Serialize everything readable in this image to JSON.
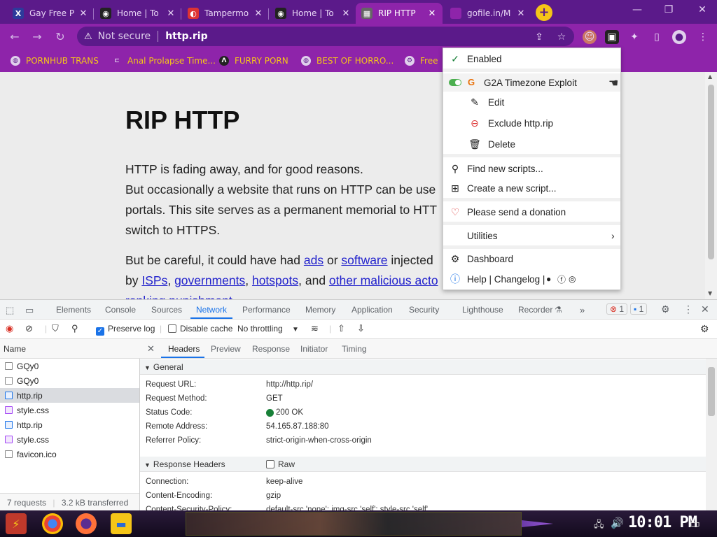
{
  "tabs": [
    {
      "title": "Gay Free P",
      "fav": "X",
      "fav_color": "#2d3a9b"
    },
    {
      "title": "Home | To",
      "fav": "⬤",
      "fav_color": "#222"
    },
    {
      "title": "Tampermo",
      "fav": "◐",
      "fav_color": "#d33"
    },
    {
      "title": "Home | To",
      "fav": "⬤",
      "fav_color": "#222"
    },
    {
      "title": "RIP HTTP",
      "fav": "▦",
      "fav_color": "#666"
    },
    {
      "title": "gofile.in/M",
      "fav": "",
      "fav_color": "#8e24aa"
    }
  ],
  "toolbar": {
    "not_secure": "Not secure",
    "url": "http.rip"
  },
  "bookmarks": [
    {
      "label": "PORNHUB TRANS",
      "icon": "globe-icon"
    },
    {
      "label": "Anal Prolapse Time...",
      "icon": "bookmark-icon"
    },
    {
      "label": "FURRY PORN",
      "icon": "lambda-icon"
    },
    {
      "label": "BEST OF HORRO...",
      "icon": "globe-icon"
    },
    {
      "label": "Free",
      "icon": "bookmark-icon"
    }
  ],
  "page": {
    "title": "RIP HTTP",
    "para1_l1": "HTTP is fading away, and for good reasons.",
    "para1_l2": "But occasionally a website that runs on HTTP can be use",
    "para1_l3": "portals. This site serves as a permanent memorial to HTT",
    "para1_l4": "switch to HTTPS.",
    "para2_pre": "But be careful, it could have had ",
    "para2_ads": "ads",
    "para2_or": " or ",
    "para2_software": "software",
    "para2_post": " injected",
    "para3_by": "by ",
    "para3_isps": "ISPs",
    "para3_c1": ", ",
    "para3_govs": "governments",
    "para3_c2": ", ",
    "para3_hotspots": "hotspots",
    "para3_and": ", and ",
    "para3_other": "other malicious acto",
    "para4": "ranking punishment."
  },
  "tampermonkey": {
    "enabled": "Enabled",
    "script": "G2A Timezone Exploit",
    "edit": "Edit",
    "exclude": "Exclude http.rip",
    "delete": "Delete",
    "find": "Find new scripts...",
    "create": "Create a new script...",
    "donate": "Please send a donation",
    "utilities": "Utilities",
    "dashboard": "Dashboard",
    "help": "Help | Changelog |"
  },
  "devtools": {
    "tabs": [
      "Elements",
      "Console",
      "Sources",
      "Network",
      "Performance",
      "Memory",
      "Application",
      "Security",
      "Lighthouse",
      "Recorder"
    ],
    "errors": "1",
    "messages": "1",
    "preserve_log": "Preserve log",
    "disable_cache": "Disable cache",
    "throttling": "No throttling",
    "name_header": "Name",
    "requests": [
      {
        "name": "GQy0",
        "type": "other"
      },
      {
        "name": "GQy0",
        "type": "other"
      },
      {
        "name": "http.rip",
        "type": "doc"
      },
      {
        "name": "style.css",
        "type": "css"
      },
      {
        "name": "http.rip",
        "type": "doc"
      },
      {
        "name": "style.css",
        "type": "css"
      },
      {
        "name": "favicon.ico",
        "type": "other"
      }
    ],
    "footer_requests": "7 requests",
    "footer_transferred": "3.2 kB transferred",
    "detail_tabs": [
      "Headers",
      "Preview",
      "Response",
      "Initiator",
      "Timing"
    ],
    "general": "General",
    "general_rows": [
      {
        "k": "Request URL:",
        "v": "http://http.rip/"
      },
      {
        "k": "Request Method:",
        "v": "GET"
      },
      {
        "k": "Status Code:",
        "v": "200 OK"
      },
      {
        "k": "Remote Address:",
        "v": "54.165.87.188:80"
      },
      {
        "k": "Referrer Policy:",
        "v": "strict-origin-when-cross-origin"
      }
    ],
    "response_headers": "Response Headers",
    "raw": "Raw",
    "resp_rows": [
      {
        "k": "Connection:",
        "v": "keep-alive"
      },
      {
        "k": "Content-Encoding:",
        "v": "gzip"
      },
      {
        "k": "Content-Security-Policy:",
        "v": "default-src 'none'; img-src 'self'; style-src 'self'"
      }
    ]
  },
  "taskbar": {
    "clock": "10:01 PM"
  }
}
